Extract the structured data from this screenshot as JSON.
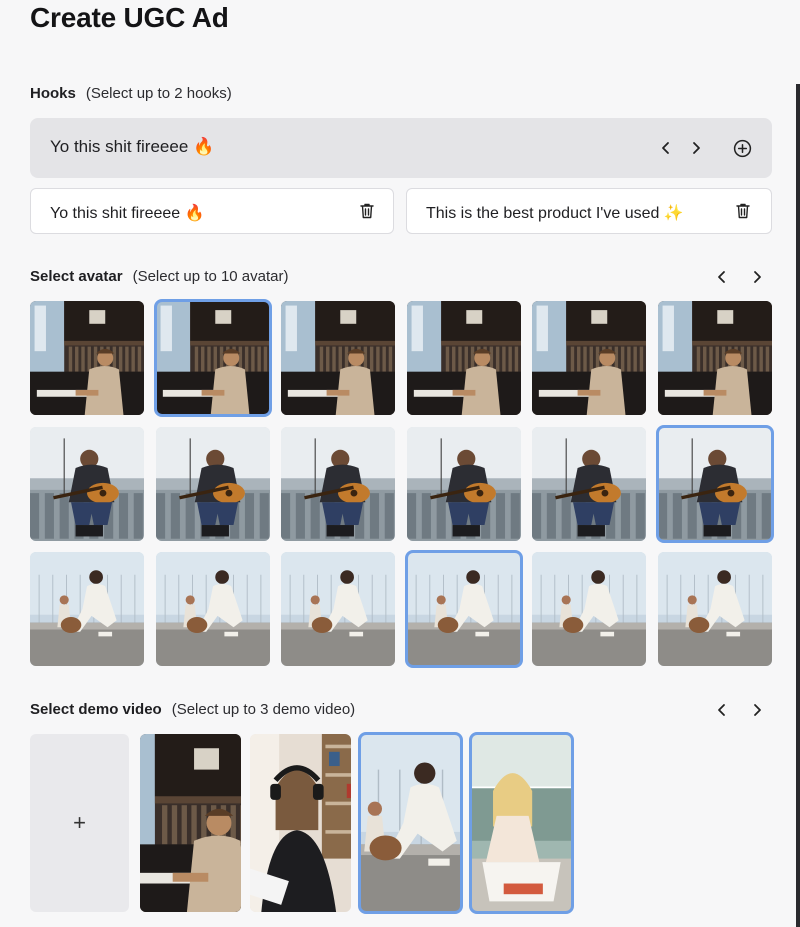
{
  "page": {
    "title": "Create UGC Ad"
  },
  "hooks": {
    "label": "Hooks",
    "hint": "(Select up to 2 hooks)",
    "current": "Yo this shit fireeee 🔥",
    "selected": [
      {
        "text": "Yo this shit fireeee 🔥"
      },
      {
        "text": "This is the best product I've used ✨"
      }
    ]
  },
  "avatar": {
    "label": "Select avatar",
    "hint": "(Select up to 10 avatar)",
    "rows": [
      {
        "scene": "piano-man",
        "selected_index": 1
      },
      {
        "scene": "guitar-man",
        "selected_index": 5
      },
      {
        "scene": "squat-woman",
        "selected_index": 3
      }
    ]
  },
  "demo": {
    "label": "Select demo video",
    "hint": "(Select up to 3 demo video)",
    "add_label": "+",
    "videos": [
      {
        "scene": "piano-man",
        "selected": false
      },
      {
        "scene": "headphones-woman",
        "selected": false
      },
      {
        "scene": "squat-woman",
        "selected": true
      },
      {
        "scene": "sitting-woman",
        "selected": true
      }
    ]
  },
  "icons": {
    "prev": "chevron-left-icon",
    "next": "chevron-right-icon",
    "add": "plus-circle-icon",
    "delete": "trash-icon"
  },
  "colors": {
    "accent": "#6f9fe6",
    "background": "#f7f7f8",
    "hook_bar": "#e4e4e7"
  }
}
